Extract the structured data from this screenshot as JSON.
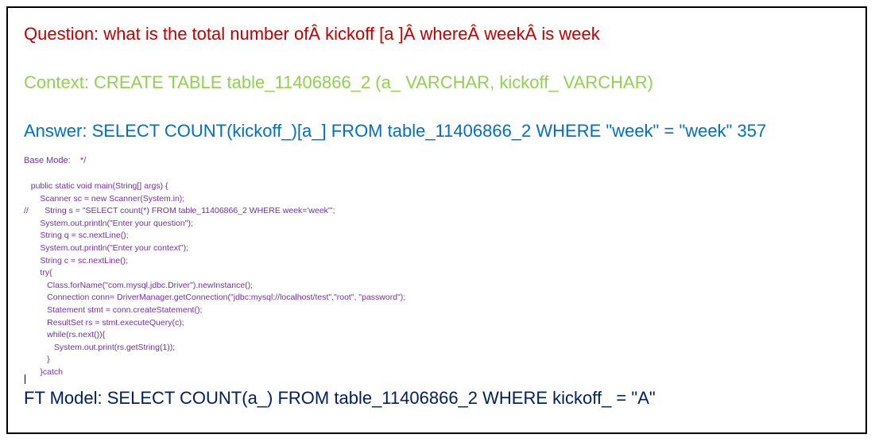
{
  "question": "Question: what is the total number ofÂ kickoff [a ]Â whereÂ weekÂ is week",
  "context": "Context: CREATE TABLE table_11406866_2 (a_ VARCHAR, kickoff_ VARCHAR)",
  "answer": "Answer: SELECT COUNT(kickoff_)[a_] FROM table_11406866_2 WHERE \"week\" = \"week\" 357",
  "base_mode": "Base Mode:    */",
  "code_lines": [
    "   public static void main(String[] args) {",
    "       Scanner sc = new Scanner(System.in);",
    "//       String s = \"SELECT count(*) FROM table_11406866_2 WHERE week='week'\";",
    "       System.out.println(\"Enter your question\");",
    "       String q = sc.nextLine();",
    "       System.out.println(\"Enter your context\");",
    "       String c = sc.nextLine();",
    "       try{",
    "          Class.forName(\"com.mysql.jdbc.Driver\").newInstance();",
    "          Connection conn= DriverManager.getConnection(\"jdbc:mysql://localhost/test\",\"root\", \"password\");",
    "          Statement stmt = conn.createStatement();",
    "          ResultSet rs = stmt.executeQuery(c);",
    "          while(rs.next()){",
    "             System.out.print(rs.getString(1));",
    "          }",
    "       }catch"
  ],
  "ft_model": "FT Model: SELECT COUNT(a_) FROM table_11406866_2 WHERE kickoff_ = \"A\""
}
